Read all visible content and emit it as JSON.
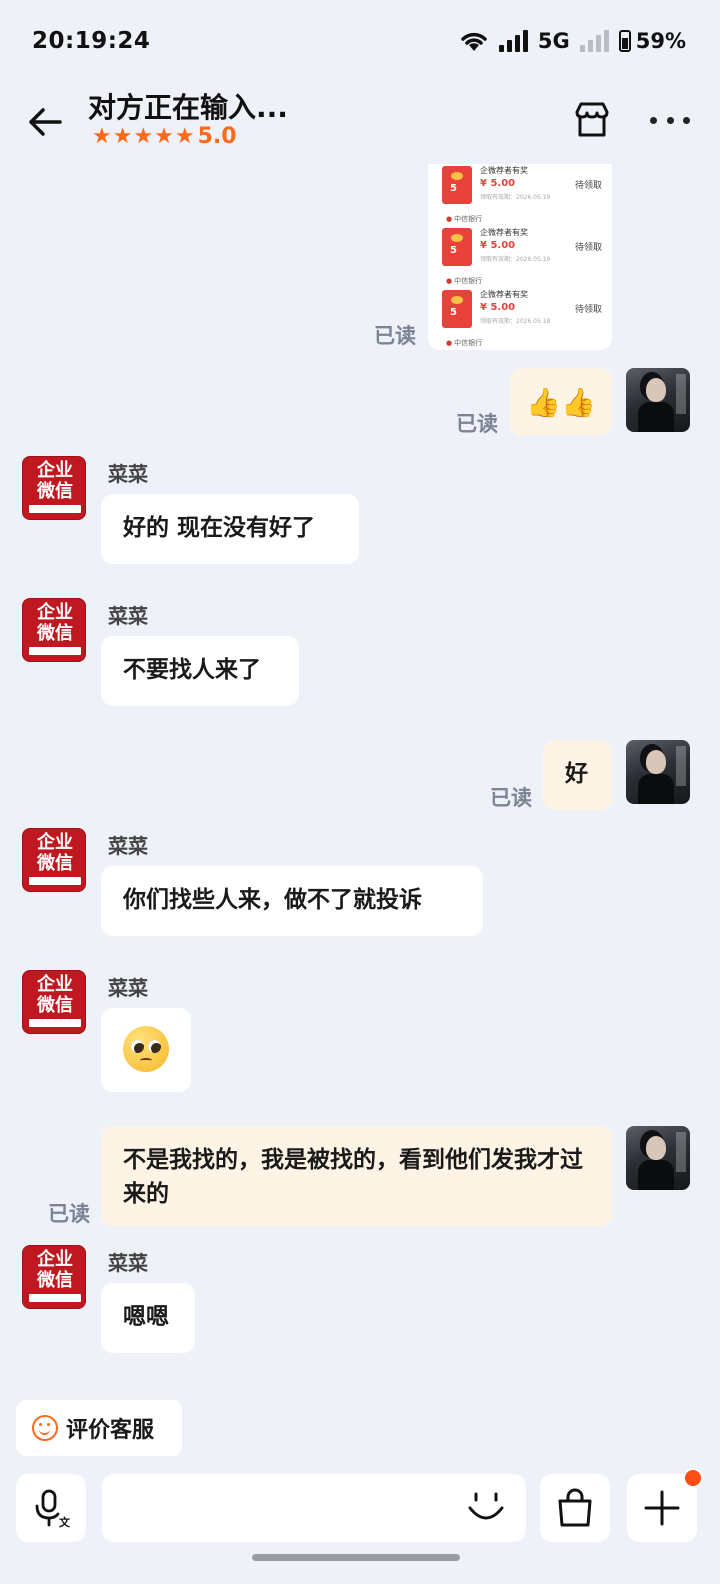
{
  "status_bar": {
    "time": "20:19:24",
    "network": "5G",
    "battery": "59%"
  },
  "header": {
    "title": "对方正在输入...",
    "stars": "★★★★★",
    "rating": "5.0",
    "accent_color": "#ff6a1a"
  },
  "image_message": {
    "red_packets": [
      {
        "name": "企微荐者有奖",
        "amount": "¥ 5.00",
        "status": "待领取",
        "date": "领取有效期：2026.05.19",
        "bank": "中信银行"
      },
      {
        "name": "企微荐者有奖",
        "amount": "¥ 5.00",
        "status": "待领取",
        "date": "领取有效期：2026.05.19",
        "bank": "中信银行"
      },
      {
        "name": "企微荐者有奖",
        "amount": "¥ 5.00",
        "status": "待领取",
        "date": "领取有效期：2026.05.18",
        "bank": "中信银行"
      }
    ],
    "envelope_number": "5"
  },
  "contact": {
    "name": "菜菜",
    "avatar_line1": "企业",
    "avatar_line2": "微信"
  },
  "read_label": "已读",
  "messages": {
    "m_thumbs": "👍👍",
    "m1": "好的 现在没有好了",
    "m2": "不要找人来了",
    "m3": "好",
    "m4": "你们找些人来，做不了就投诉",
    "m5_icon": "pleading-face-emoji",
    "m6": "不是我找的，我是被找的，看到他们发我才过来的",
    "m7": "嗯嗯"
  },
  "rate_button": {
    "label": "评价客服"
  },
  "input": {
    "placeholder": ""
  },
  "icons": {
    "voice": "voice-input-icon",
    "emoji": "emoji-icon",
    "shop": "shopping-bag-icon",
    "plus": "plus-icon"
  }
}
